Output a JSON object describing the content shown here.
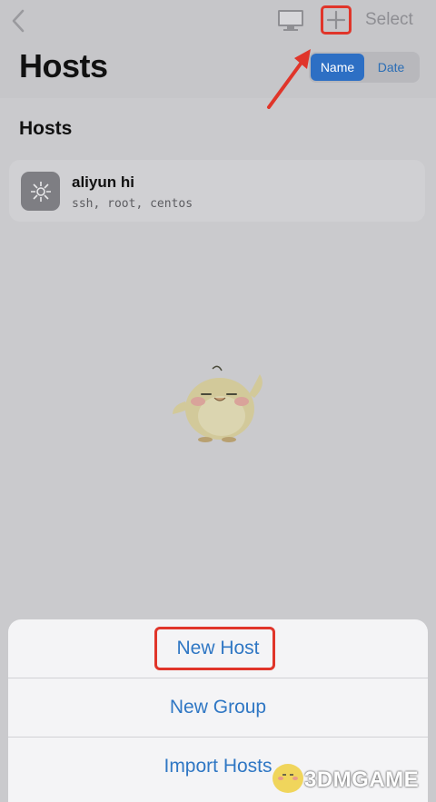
{
  "nav": {
    "back_icon": "chevron-left-icon",
    "monitor_icon": "monitor-icon",
    "add_icon": "plus-icon",
    "select_label": "Select"
  },
  "header": {
    "title": "Hosts",
    "sort": {
      "options": [
        "Name",
        "Date"
      ],
      "selected": "Name"
    }
  },
  "section": {
    "title": "Hosts"
  },
  "hosts": [
    {
      "name": "aliyun hi",
      "meta": "ssh, root, centos",
      "icon": "server-icon"
    }
  ],
  "action_sheet": {
    "items": [
      "New Host",
      "New Group",
      "Import Hosts"
    ]
  },
  "watermark": {
    "text": "3DMGAME"
  },
  "colors": {
    "accent": "#2d6fc4",
    "annotation": "#e0352a",
    "link": "#2f77c4"
  }
}
